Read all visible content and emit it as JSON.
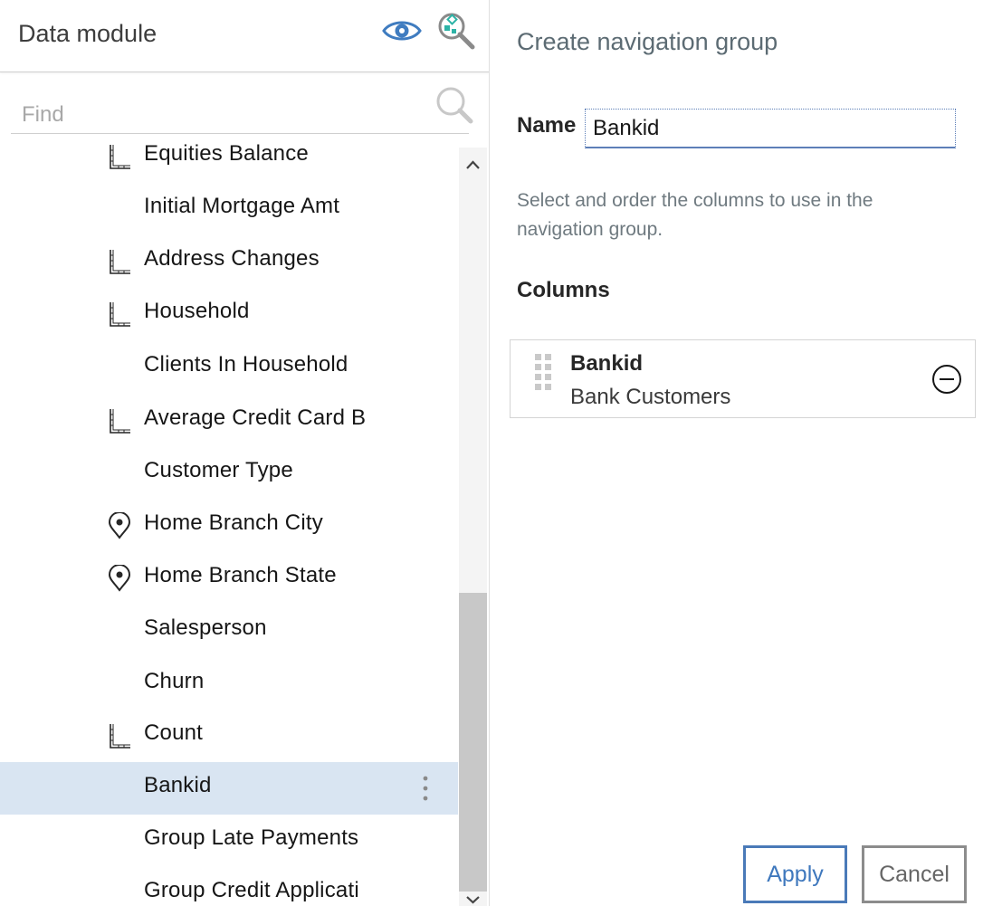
{
  "data_module": {
    "title": "Data module",
    "find_placeholder": "Find"
  },
  "tree": {
    "items": [
      {
        "label": "Equities Balance",
        "icon": "measure-icon"
      },
      {
        "label": "Initial Mortgage Amt",
        "icon": ""
      },
      {
        "label": "Address Changes",
        "icon": "measure-icon"
      },
      {
        "label": "Household",
        "icon": "measure-icon"
      },
      {
        "label": "Clients In Household",
        "icon": ""
      },
      {
        "label": "Average Credit Card B",
        "icon": "measure-icon"
      },
      {
        "label": "Customer Type",
        "icon": ""
      },
      {
        "label": "Home Branch City",
        "icon": "location-pin-icon"
      },
      {
        "label": "Home Branch State",
        "icon": "location-pin-icon"
      },
      {
        "label": "Salesperson",
        "icon": ""
      },
      {
        "label": "Churn",
        "icon": ""
      },
      {
        "label": "Count",
        "icon": "measure-icon"
      },
      {
        "label": "Bankid",
        "icon": "",
        "selected": true
      },
      {
        "label": "Group Late Payments",
        "icon": ""
      },
      {
        "label": "Group Credit Applicati",
        "icon": ""
      }
    ]
  },
  "nav_group": {
    "title": "Create navigation group",
    "name_label": "Name",
    "name_value": "Bankid",
    "instructions": "Select and order the columns to use in the navigation group.",
    "columns_label": "Columns",
    "columns": [
      {
        "name": "Bankid",
        "source": "Bank Customers"
      }
    ],
    "apply_label": "Apply",
    "cancel_label": "Cancel"
  },
  "colors": {
    "accent": "#4a7ab8",
    "selected_row": "#d9e5f2",
    "eye_icon": "#3f7cc0",
    "zoom_diamond": "#2db3a6"
  }
}
